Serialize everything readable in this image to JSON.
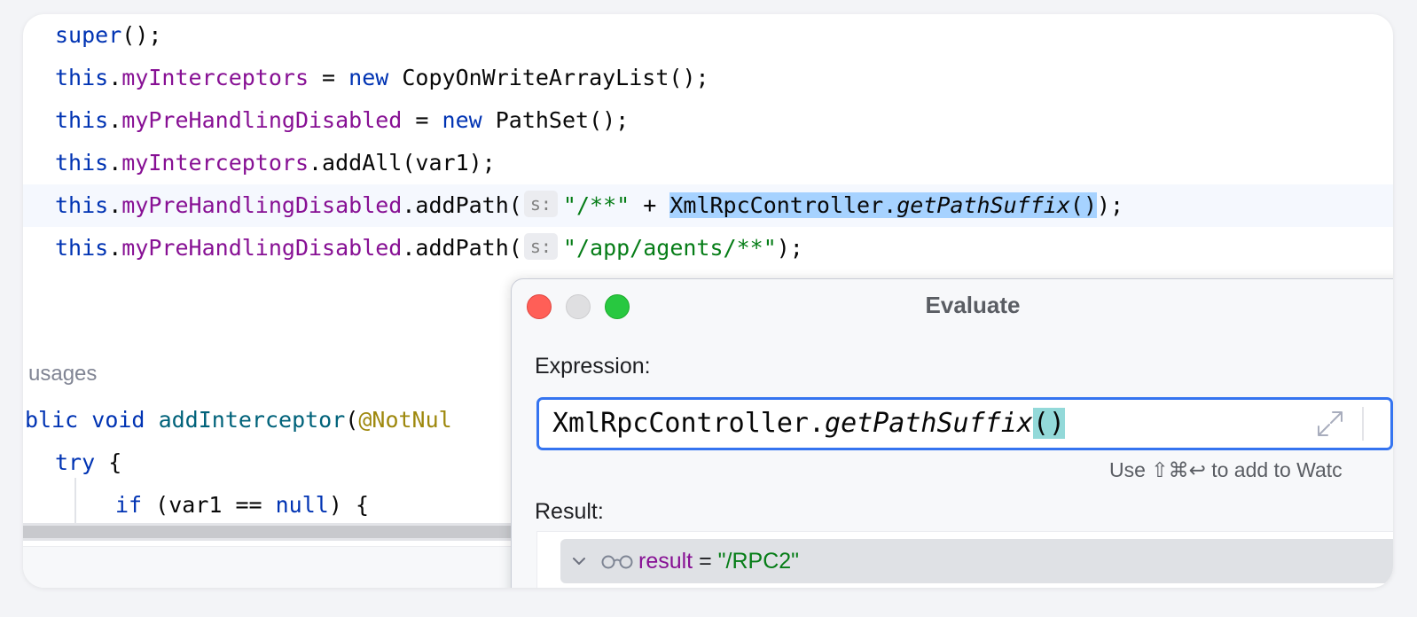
{
  "code": {
    "line1": {
      "kw": "super",
      "rest": "();"
    },
    "line2": {
      "this": "this",
      "dot": ".",
      "field": "myInterceptors",
      "eq": " = ",
      "new": "new",
      "rest": " CopyOnWriteArrayList();"
    },
    "line3": {
      "this": "this",
      "dot": ".",
      "field": "myPreHandlingDisabled",
      "eq": " = ",
      "new": "new",
      "rest": " PathSet();"
    },
    "line4": {
      "this": "this",
      "dot": ".",
      "field": "myInterceptors",
      "rest": ".addAll(var1);"
    },
    "line5": {
      "this": "this",
      "dot": ".",
      "field": "myPreHandlingDisabled",
      "call": ".addPath(",
      "hint": "s:",
      "str": "\"/**\"",
      "plus": " + ",
      "cls": "XmlRpcController.",
      "method": "getPathSuffix",
      "parens": "()",
      "end": ");"
    },
    "line6": {
      "this": "this",
      "dot": ".",
      "field": "myPreHandlingDisabled",
      "call": ".addPath(",
      "hint": "s:",
      "str": "\"/app/agents/**\"",
      "end": ");"
    },
    "usages": "usages",
    "line7": {
      "pre": "blic",
      "void": "void",
      "method": "addInterceptor",
      "paren": "(",
      "ann": "@NotNul"
    },
    "line8": {
      "try": "try",
      "rest": " {"
    },
    "line9": {
      "if": "if",
      "mid": " (var1 == ",
      "null": "null",
      "rest": ") {"
    }
  },
  "dialog": {
    "title": "Evaluate",
    "expression_label": "Expression:",
    "expression": {
      "cls": "XmlRpcController.",
      "method": "getPathSuffix",
      "parens": "()"
    },
    "watch_hint": "Use ⇧⌘↩ to add to Watc",
    "result_label": "Result:",
    "result": {
      "name": "result",
      "eq": " = ",
      "value": "\"/RPC2\""
    }
  },
  "colors": {
    "keyword": "#0033b3",
    "field": "#871094",
    "string": "#067d17",
    "function": "#00627a",
    "annotation": "#9e880d",
    "selection": "#a6d2ff",
    "focus_border": "#3574f0"
  },
  "icons": [
    "close-window-icon",
    "minimize-window-icon",
    "maximize-window-icon",
    "expand-icon",
    "chevron-down-icon",
    "glasses-icon"
  ]
}
